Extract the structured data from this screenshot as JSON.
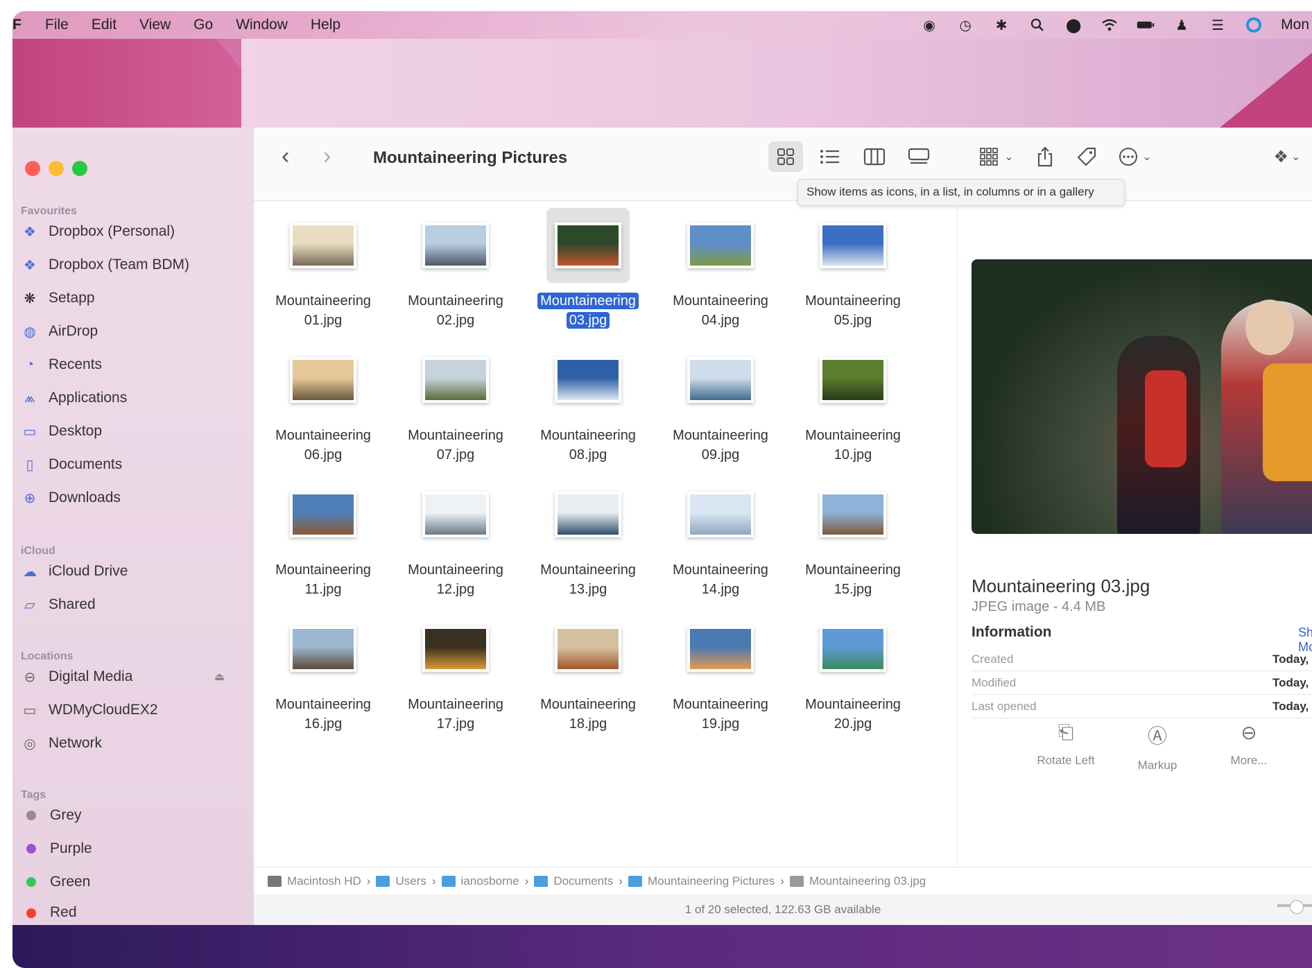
{
  "menubar": {
    "app": "Finder",
    "items": [
      "File",
      "Edit",
      "View",
      "Go",
      "Window",
      "Help"
    ],
    "clock": "Mon"
  },
  "window": {
    "title": "Mountaineering Pictures",
    "tooltip": "Show items as icons, in a list, in columns or in a gallery"
  },
  "sidebar": {
    "favourites_header": "Favourites",
    "favourites": [
      {
        "label": "Dropbox (Personal)",
        "icon": "dropbox-icon"
      },
      {
        "label": "Dropbox (Team BDM)",
        "icon": "dropbox-icon"
      },
      {
        "label": "Setapp",
        "icon": "setapp-icon"
      },
      {
        "label": "AirDrop",
        "icon": "airdrop-icon"
      },
      {
        "label": "Recents",
        "icon": "clock-icon"
      },
      {
        "label": "Applications",
        "icon": "applications-icon"
      },
      {
        "label": "Desktop",
        "icon": "desktop-icon"
      },
      {
        "label": "Documents",
        "icon": "document-icon"
      },
      {
        "label": "Downloads",
        "icon": "download-icon"
      }
    ],
    "icloud_header": "iCloud",
    "icloud": [
      {
        "label": "iCloud Drive",
        "icon": "cloud-icon"
      },
      {
        "label": "Shared",
        "icon": "shared-folder-icon"
      }
    ],
    "locations_header": "Locations",
    "locations": [
      {
        "label": "Digital Media",
        "icon": "drive-icon"
      },
      {
        "label": "WDMyCloudEX2",
        "icon": "display-icon"
      },
      {
        "label": "Network",
        "icon": "network-icon"
      }
    ],
    "tags_header": "Tags",
    "tags": [
      {
        "label": "Grey",
        "color": "#8e8e93"
      },
      {
        "label": "Purple",
        "color": "#a14fd6"
      },
      {
        "label": "Green",
        "color": "#34c759"
      },
      {
        "label": "Red",
        "color": "#ff3b30"
      }
    ]
  },
  "files": [
    {
      "line1": "Mountaineering",
      "line2": "01.jpg",
      "thumb": [
        "#e9dcc0",
        "#7a6a55"
      ]
    },
    {
      "line1": "Mountaineering",
      "line2": "02.jpg",
      "thumb": [
        "#b9cde0",
        "#4d5866"
      ]
    },
    {
      "line1": "Mountaineering",
      "line2": "03.jpg",
      "thumb": [
        "#2c4a2a",
        "#c2542c"
      ]
    },
    {
      "line1": "Mountaineering",
      "line2": "04.jpg",
      "thumb": [
        "#5f8fc9",
        "#7c9a4a"
      ]
    },
    {
      "line1": "Mountaineering",
      "line2": "05.jpg",
      "thumb": [
        "#3b6fc2",
        "#d9e2ee"
      ]
    },
    {
      "line1": "Mountaineering",
      "line2": "06.jpg",
      "thumb": [
        "#e6c79a",
        "#6b5a3d"
      ]
    },
    {
      "line1": "Mountaineering",
      "line2": "07.jpg",
      "thumb": [
        "#c6d3dd",
        "#5c6b3c"
      ]
    },
    {
      "line1": "Mountaineering",
      "line2": "08.jpg",
      "thumb": [
        "#2f5fa8",
        "#dfe7f0"
      ]
    },
    {
      "line1": "Mountaineering",
      "line2": "09.jpg",
      "thumb": [
        "#cfdcea",
        "#3f6b8c"
      ]
    },
    {
      "line1": "Mountaineering",
      "line2": "10.jpg",
      "thumb": [
        "#5a7d2e",
        "#2b3a1a"
      ]
    },
    {
      "line1": "Mountaineering",
      "line2": "11.jpg",
      "thumb": [
        "#4f7fb8",
        "#8a5b3a"
      ]
    },
    {
      "line1": "Mountaineering",
      "line2": "12.jpg",
      "thumb": [
        "#eef2f4",
        "#6b7b88"
      ]
    },
    {
      "line1": "Mountaineering",
      "line2": "13.jpg",
      "thumb": [
        "#e8edf1",
        "#30506e"
      ]
    },
    {
      "line1": "Mountaineering",
      "line2": "14.jpg",
      "thumb": [
        "#d9e6f2",
        "#8fa7bf"
      ]
    },
    {
      "line1": "Mountaineering",
      "line2": "15.jpg",
      "thumb": [
        "#8fb2d8",
        "#7d5a3a"
      ]
    },
    {
      "line1": "Mountaineering",
      "line2": "16.jpg",
      "thumb": [
        "#9bb6cf",
        "#5d4a3a"
      ]
    },
    {
      "line1": "Mountaineering",
      "line2": "17.jpg",
      "thumb": [
        "#3a3020",
        "#d99a3a"
      ]
    },
    {
      "line1": "Mountaineering",
      "line2": "18.jpg",
      "thumb": [
        "#d7c0a0",
        "#a0582a"
      ]
    },
    {
      "line1": "Mountaineering",
      "line2": "19.jpg",
      "thumb": [
        "#4a7ab2",
        "#e39a52"
      ]
    },
    {
      "line1": "Mountaineering",
      "line2": "20.jpg",
      "thumb": [
        "#5e9bd6",
        "#3a8a5a"
      ]
    }
  ],
  "selected_index": 2,
  "preview": {
    "name": "Mountaineering 03.jpg",
    "type": "JPEG image - 4.4 MB",
    "info_header": "Information",
    "show_more": "Show More",
    "rows": [
      {
        "label": "Created",
        "value": "Today,"
      },
      {
        "label": "Modified",
        "value": "Today,"
      },
      {
        "label": "Last opened",
        "value": "Today,"
      }
    ],
    "actions": [
      {
        "label": "Rotate Left",
        "icon": "rotate-left-icon"
      },
      {
        "label": "Markup",
        "icon": "markup-icon"
      },
      {
        "label": "More...",
        "icon": "more-icon"
      }
    ]
  },
  "pathbar": [
    {
      "label": "Macintosh HD",
      "color": "#777777"
    },
    {
      "label": "Users",
      "color": "#4a9fe0"
    },
    {
      "label": "ianosborne",
      "color": "#4a9fe0"
    },
    {
      "label": "Documents",
      "color": "#4a9fe0"
    },
    {
      "label": "Mountaineering Pictures",
      "color": "#4a9fe0"
    },
    {
      "label": "Mountaineering 03.jpg",
      "color": "#999999"
    }
  ],
  "status": "1 of 20 selected, 122.63 GB available",
  "colors": {
    "selection": "#2f64d6",
    "close": "#ff5f57",
    "minimize": "#febc2e",
    "zoom": "#28c840"
  }
}
